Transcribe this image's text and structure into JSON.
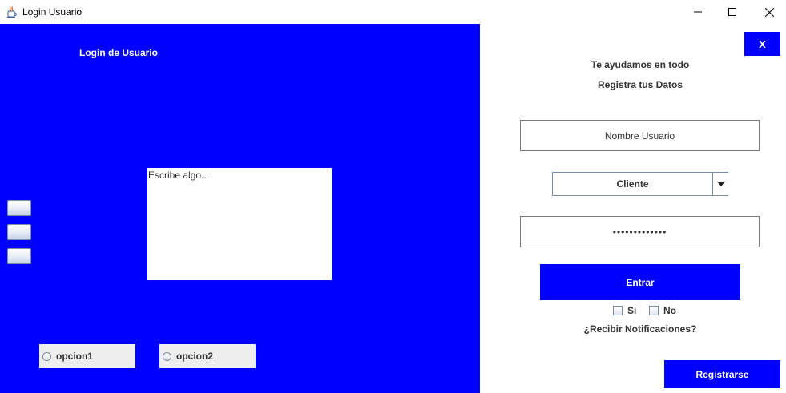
{
  "window": {
    "title": "Login Usuario",
    "icons": {
      "app": "java-cup-icon",
      "minimize": "minimize-icon",
      "maximize": "maximize-icon",
      "close": "close-icon"
    }
  },
  "left_panel": {
    "title": "Login de Usuario",
    "textarea_value": "Escribe algo...",
    "small_buttons": [
      "",
      "",
      ""
    ],
    "radios": [
      {
        "label": "opcion1",
        "selected": false
      },
      {
        "label": "opcion2",
        "selected": false
      }
    ],
    "background": "#0000ff"
  },
  "right_panel": {
    "close_label": "X",
    "help_text": "Te ayudamos en todo",
    "register_data_text": "Registra tus Datos",
    "username_placeholder": "Nombre Usuario",
    "role_selected": "Cliente",
    "password_value": "•••••••••••••",
    "enter_label": "Entrar",
    "checkboxes": [
      {
        "label": "Si",
        "checked": false
      },
      {
        "label": "No",
        "checked": false
      }
    ],
    "notifications_question": "¿Recibir Notificaciones?",
    "register_label": "Registrarse",
    "accent": "#0000ff"
  }
}
